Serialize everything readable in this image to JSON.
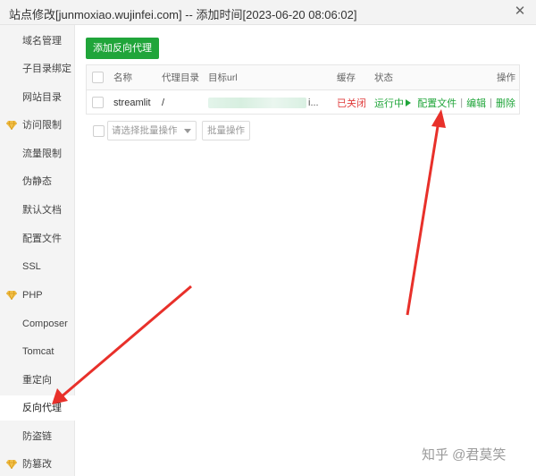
{
  "window": {
    "title": "站点修改[junmoxiao.wujinfei.com] -- 添加时间[2023-06-20 08:06:02]",
    "close_glyph": "✕"
  },
  "sidebar": {
    "items": [
      {
        "label": "域名管理",
        "icon": null
      },
      {
        "label": "子目录绑定",
        "icon": null
      },
      {
        "label": "网站目录",
        "icon": null
      },
      {
        "label": "访问限制",
        "icon": "gem-icon"
      },
      {
        "label": "流量限制",
        "icon": null
      },
      {
        "label": "伪静态",
        "icon": null
      },
      {
        "label": "默认文档",
        "icon": null
      },
      {
        "label": "配置文件",
        "icon": null
      },
      {
        "label": "SSL",
        "icon": null
      },
      {
        "label": "PHP",
        "icon": "gem-icon"
      },
      {
        "label": "Composer",
        "icon": null
      },
      {
        "label": "Tomcat",
        "icon": null
      },
      {
        "label": "重定向",
        "icon": null
      },
      {
        "label": "反向代理",
        "icon": null,
        "active": true
      },
      {
        "label": "防盗链",
        "icon": null
      },
      {
        "label": "防篡改",
        "icon": "gem-icon"
      }
    ]
  },
  "toolbar": {
    "add_label": "添加反向代理"
  },
  "table": {
    "headers": {
      "name": "名称",
      "proxy_dir": "代理目录",
      "target_url": "目标url",
      "cache": "缓存",
      "status": "状态",
      "actions": "操作"
    },
    "rows": [
      {
        "name": "streamlit",
        "proxy_dir": "/",
        "target_url_tail": "i...",
        "cache": "已关闭",
        "status": "运行中",
        "actions": [
          "配置文件",
          "编辑",
          "删除"
        ]
      }
    ]
  },
  "batch": {
    "select_placeholder": "请选择批量操作",
    "button_label": "批量操作"
  },
  "watermark": "知乎 @君莫笑",
  "colors": {
    "accent": "#20a53a",
    "danger": "#e03b3b",
    "annotation_arrow": "#e8302a"
  }
}
